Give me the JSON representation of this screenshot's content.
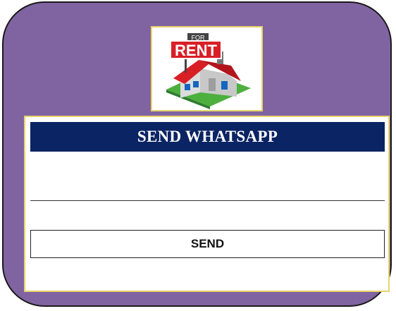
{
  "logo": {
    "sign_top": "FOR",
    "sign_main": "RENT"
  },
  "header": {
    "title": "SEND WHATSAPP"
  },
  "message": {
    "value": "",
    "placeholder": ""
  },
  "actions": {
    "send_label": "SEND"
  },
  "colors": {
    "background_frame": "#8064a2",
    "title_bar": "#0b2463",
    "panel_border": "#e8d46a"
  }
}
